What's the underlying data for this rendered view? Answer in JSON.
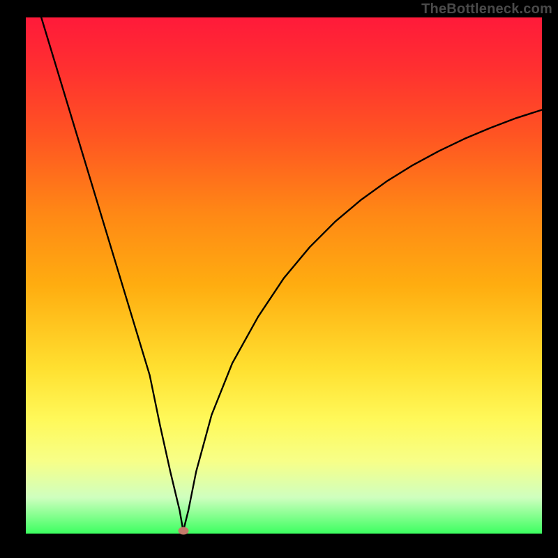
{
  "watermark": "TheBottleneck.com",
  "chart_data": {
    "type": "line",
    "title": "",
    "xlabel": "",
    "ylabel": "",
    "xlim": [
      0,
      100
    ],
    "ylim": [
      0,
      100
    ],
    "x": [
      3,
      6,
      9,
      12,
      15,
      18,
      21,
      24,
      26,
      28,
      29.8,
      30.5,
      31.5,
      33,
      36,
      40,
      45,
      50,
      55,
      60,
      65,
      70,
      75,
      80,
      85,
      90,
      95,
      100
    ],
    "values": [
      100,
      90.1,
      80.2,
      70.3,
      60.4,
      50.5,
      40.6,
      30.7,
      21,
      12,
      4.5,
      0.5,
      4.5,
      12,
      23,
      33,
      42,
      49.5,
      55.5,
      60.5,
      64.7,
      68.3,
      71.4,
      74.1,
      76.5,
      78.6,
      80.5,
      82.1
    ],
    "marker": {
      "x": 30.5,
      "y": 0.5
    },
    "background_gradient": [
      "#ff1a3a",
      "#ff8815",
      "#fff95a",
      "#3cff60"
    ]
  }
}
